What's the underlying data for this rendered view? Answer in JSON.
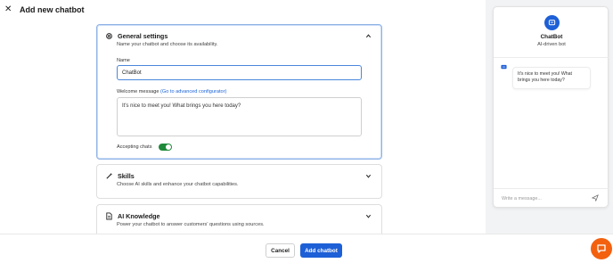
{
  "header": {
    "title": "Add new chatbot",
    "close_icon": "close-icon"
  },
  "general": {
    "title": "General settings",
    "subtitle": "Name your chatbot and choose its availability.",
    "name_label": "Name",
    "name_value": "ChatBot",
    "welcome_label": "Welcome message",
    "welcome_link": "(Go to advanced configurator)",
    "welcome_value": "It's nice to meet you! What brings you here today?",
    "accepting_label": "Accepting chats",
    "accepting_on": true
  },
  "skills": {
    "title": "Skills",
    "subtitle": "Choose AI skills and enhance your chatbot capabilities."
  },
  "knowledge": {
    "title": "AI Knowledge",
    "subtitle": "Power your chatbot to answer customers' questions using sources."
  },
  "footer": {
    "cancel_label": "Cancel",
    "add_label": "Add chatbot"
  },
  "preview": {
    "bot_name": "ChatBot",
    "bot_desc": "AI-driven bot",
    "message": "It's nice to meet you! What brings you here today?",
    "composer_placeholder": "Write a message..."
  },
  "colors": {
    "accent": "#1d5fd6",
    "toggle_on": "#1f8a3a",
    "launcher": "#f3610f"
  }
}
